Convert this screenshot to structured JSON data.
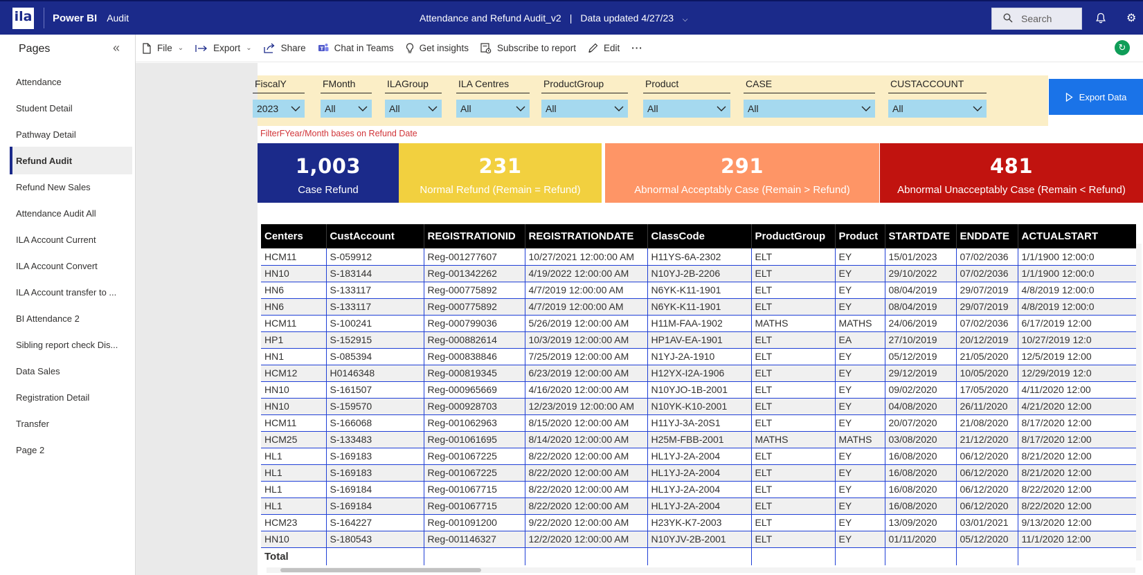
{
  "topbar": {
    "logo_text": "ila",
    "brand": "Power BI",
    "workspace": "Audit",
    "report_title": "Attendance and Refund Audit_v2",
    "divider": "|",
    "data_updated": "Data updated 4/27/23",
    "search_placeholder": "Search"
  },
  "sidebar": {
    "title": "Pages",
    "items": [
      {
        "label": "Attendance"
      },
      {
        "label": "Student Detail"
      },
      {
        "label": "Pathway Detail"
      },
      {
        "label": "Refund Audit",
        "active": true
      },
      {
        "label": "Refund New Sales"
      },
      {
        "label": "Attendance Audit All"
      },
      {
        "label": "ILA Account Current"
      },
      {
        "label": "ILA Account Convert"
      },
      {
        "label": "ILA Account transfer to ..."
      },
      {
        "label": "BI Attendance 2"
      },
      {
        "label": "Sibling report check Dis..."
      },
      {
        "label": "Data Sales"
      },
      {
        "label": "Registration Detail"
      },
      {
        "label": "Transfer"
      },
      {
        "label": "Page 2"
      }
    ]
  },
  "toolbar": {
    "file": "File",
    "export": "Export",
    "share": "Share",
    "chat": "Chat in Teams",
    "insights": "Get insights",
    "subscribe": "Subscribe to report",
    "edit": "Edit",
    "more": "···"
  },
  "slicers": [
    {
      "label": "FiscalY",
      "value": "2023"
    },
    {
      "label": "FMonth",
      "value": "All"
    },
    {
      "label": "ILAGroup",
      "value": "All"
    },
    {
      "label": "ILA Centres",
      "value": "All"
    },
    {
      "label": "ProductGroup",
      "value": "All"
    },
    {
      "label": "Product",
      "value": "All"
    },
    {
      "label": "CASE",
      "value": "All"
    },
    {
      "label": "CUSTACCOUNT",
      "value": "All"
    }
  ],
  "export_button": "Export Data",
  "filter_note": "FilterFYear/Month bases on  Refund Date",
  "kpis": [
    {
      "value": "1,003",
      "caption": "Case Refund",
      "color": "#1b2a8a"
    },
    {
      "value": "231",
      "caption": "Normal Refund (Remain = Refund)",
      "color": "#f2d03f"
    },
    {
      "value": "291",
      "caption": "Abnormal Acceptably Case (Remain > Refund)",
      "color": "#fe9566"
    },
    {
      "value": "481",
      "caption": "Abnormal Unacceptably Case (Remain < Refund)",
      "color": "#c1130f"
    }
  ],
  "table": {
    "columns": [
      "Centers",
      "CustAccount",
      "REGISTRATIONID",
      "REGISTRATIONDATE",
      "ClassCode",
      "ProductGroup",
      "Product",
      "STARTDATE",
      "ENDDATE",
      "ACTUALSTART"
    ],
    "rows": [
      [
        "HCM11",
        "S-059912",
        "Reg-001277607",
        "10/27/2021 12:00:00 AM",
        "H11YS-6A-2302",
        "ELT",
        "EY",
        "15/01/2023",
        "07/02/2036",
        "1/1/1900 12:00:0"
      ],
      [
        "HN10",
        "S-183144",
        "Reg-001342262",
        "4/19/2022 12:00:00 AM",
        "N10YJ-2B-2206",
        "ELT",
        "EY",
        "29/10/2022",
        "07/02/2036",
        "1/1/1900 12:00:0"
      ],
      [
        "HN6",
        "S-133117",
        "Reg-000775892",
        "4/7/2019 12:00:00 AM",
        "N6YK-K11-1901",
        "ELT",
        "EY",
        "08/04/2019",
        "29/07/2019",
        "4/8/2019 12:00:0"
      ],
      [
        "HN6",
        "S-133117",
        "Reg-000775892",
        "4/7/2019 12:00:00 AM",
        "N6YK-K11-1901",
        "ELT",
        "EY",
        "08/04/2019",
        "29/07/2019",
        "4/8/2019 12:00:0"
      ],
      [
        "HCM11",
        "S-100241",
        "Reg-000799036",
        "5/26/2019 12:00:00 AM",
        "H11M-FAA-1902",
        "MATHS",
        "MATHS",
        "24/06/2019",
        "07/02/2036",
        "6/17/2019 12:00"
      ],
      [
        "HP1",
        "S-152915",
        "Reg-000882614",
        "10/3/2019 12:00:00 AM",
        "HP1AV-EA-1901",
        "ELT",
        "EA",
        "27/10/2019",
        "20/12/2019",
        "10/27/2019 12:0"
      ],
      [
        "HN1",
        "S-085394",
        "Reg-000838846",
        "7/25/2019 12:00:00 AM",
        "N1YJ-2A-1910",
        "ELT",
        "EY",
        "05/12/2019",
        "21/05/2020",
        "12/5/2019 12:00"
      ],
      [
        "HCM12",
        "H0146348",
        "Reg-000819345",
        "6/23/2019 12:00:00 AM",
        "H12YX-I2A-1906",
        "ELT",
        "EY",
        "29/12/2019",
        "10/05/2020",
        "12/29/2019 12:0"
      ],
      [
        "HN10",
        "S-161507",
        "Reg-000965669",
        "4/16/2020 12:00:00 AM",
        "N10YJO-1B-2001",
        "ELT",
        "EY",
        "09/02/2020",
        "17/05/2020",
        "4/11/2020 12:00"
      ],
      [
        "HN10",
        "S-159570",
        "Reg-000928703",
        "12/23/2019 12:00:00 AM",
        "N10YK-K10-2001",
        "ELT",
        "EY",
        "04/08/2020",
        "26/11/2020",
        "4/21/2020 12:00"
      ],
      [
        "HCM11",
        "S-166068",
        "Reg-001062963",
        "8/15/2020 12:00:00 AM",
        "H11YJ-3A-20S1",
        "ELT",
        "EY",
        "20/07/2020",
        "21/08/2020",
        "8/17/2020 12:00"
      ],
      [
        "HCM25",
        "S-133483",
        "Reg-001061695",
        "8/14/2020 12:00:00 AM",
        "H25M-FBB-2001",
        "MATHS",
        "MATHS",
        "03/08/2020",
        "21/12/2020",
        "8/17/2020 12:00"
      ],
      [
        "HL1",
        "S-169183",
        "Reg-001067225",
        "8/22/2020 12:00:00 AM",
        "HL1YJ-2A-2004",
        "ELT",
        "EY",
        "16/08/2020",
        "06/12/2020",
        "8/21/2020 12:00"
      ],
      [
        "HL1",
        "S-169183",
        "Reg-001067225",
        "8/22/2020 12:00:00 AM",
        "HL1YJ-2A-2004",
        "ELT",
        "EY",
        "16/08/2020",
        "06/12/2020",
        "8/21/2020 12:00"
      ],
      [
        "HL1",
        "S-169184",
        "Reg-001067715",
        "8/22/2020 12:00:00 AM",
        "HL1YJ-2A-2004",
        "ELT",
        "EY",
        "16/08/2020",
        "06/12/2020",
        "8/22/2020 12:00"
      ],
      [
        "HL1",
        "S-169184",
        "Reg-001067715",
        "8/22/2020 12:00:00 AM",
        "HL1YJ-2A-2004",
        "ELT",
        "EY",
        "16/08/2020",
        "06/12/2020",
        "8/22/2020 12:00"
      ],
      [
        "HCM23",
        "S-164227",
        "Reg-001091200",
        "9/22/2020 12:00:00 AM",
        "H23YK-K7-2003",
        "ELT",
        "EY",
        "13/09/2020",
        "03/01/2021",
        "9/13/2020 12:00"
      ],
      [
        "HN10",
        "S-180543",
        "Reg-001146327",
        "12/2/2020 12:00:00 AM",
        "N10YJV-2B-2001",
        "ELT",
        "EY",
        "01/11/2020",
        "05/12/2020",
        "11/1/2020 12:00"
      ]
    ],
    "total_label": "Total"
  }
}
